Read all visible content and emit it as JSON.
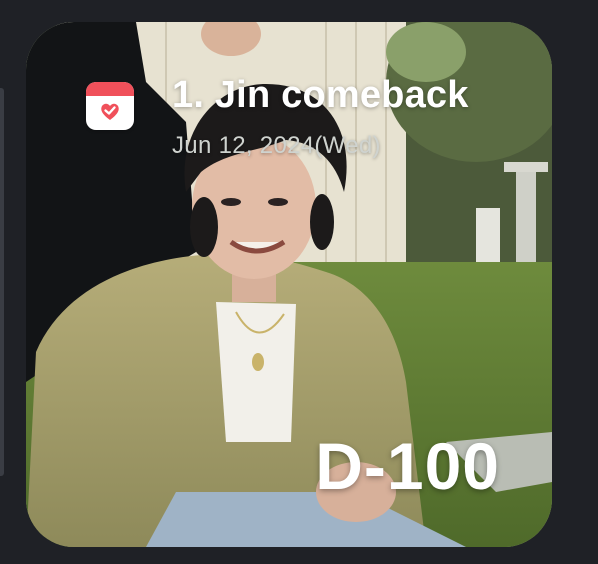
{
  "widget": {
    "title": "1. Jin comeback",
    "date": "Jun 12, 2024(Wed)",
    "countdown": "D-100",
    "icon": "calendar-check-icon",
    "accent_color": "#f0505a"
  }
}
